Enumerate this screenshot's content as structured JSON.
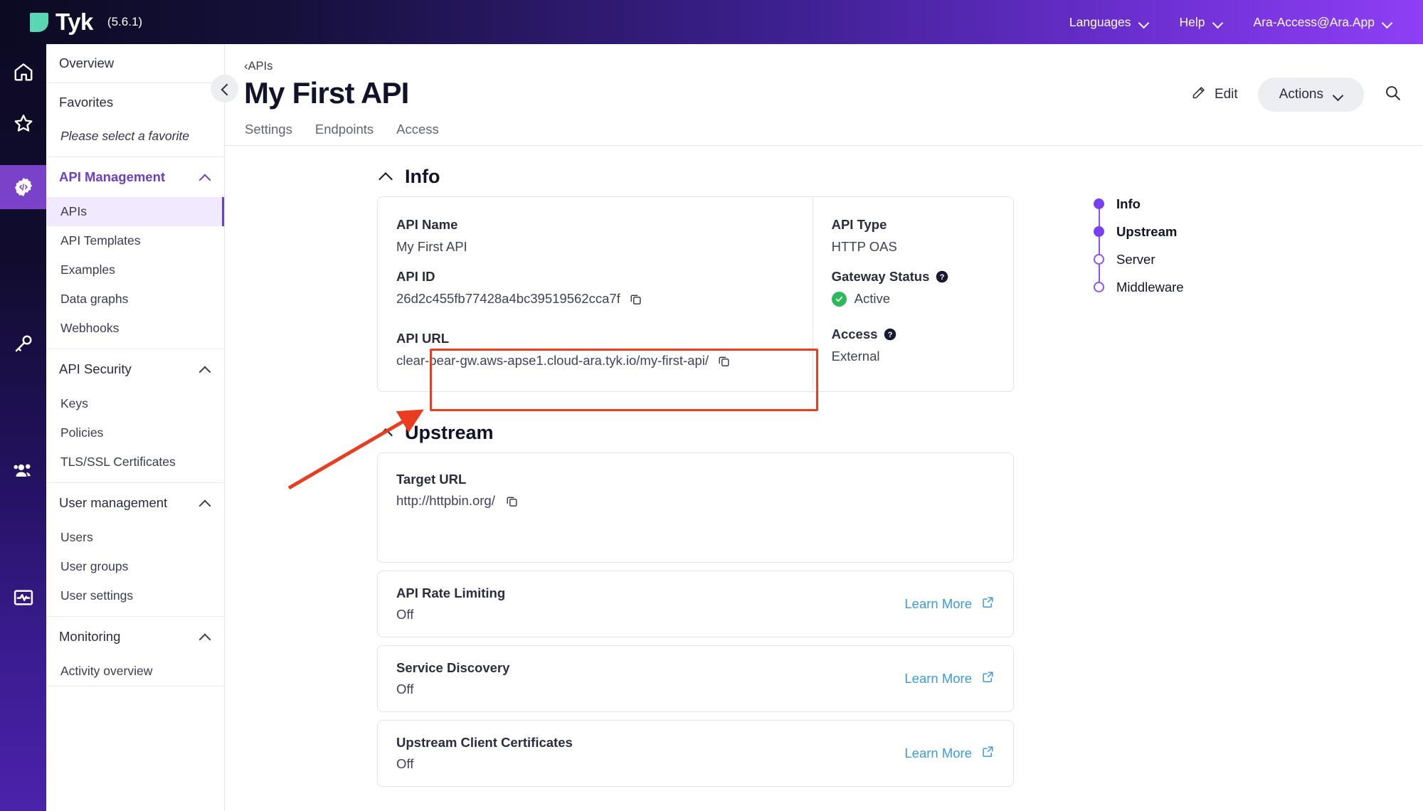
{
  "topbar": {
    "logo_word": "Tyk",
    "version": "(5.6.1)",
    "logo_icon": "tyk-logo-icon",
    "items": [
      {
        "label": "Languages",
        "icon": "chevron-down-icon"
      },
      {
        "label": "Help",
        "icon": "chevron-down-icon"
      },
      {
        "label": "Ara-Access@Ara.App",
        "icon": "chevron-down-icon"
      }
    ]
  },
  "rail": {
    "items": [
      {
        "name": "home-icon",
        "active": false
      },
      {
        "name": "star-icon",
        "active": false
      },
      {
        "name": "api-management-gear-code-icon",
        "active": true
      },
      {
        "name": "key-icon",
        "active": false
      },
      {
        "name": "users-icon",
        "active": false
      },
      {
        "name": "activity-monitor-icon",
        "active": false
      }
    ]
  },
  "sidebar": {
    "overview": "Overview",
    "favorites_title": "Favorites",
    "favorites_empty": "Please select a favorite",
    "collapse_icon": "chevron-left-icon",
    "groups": [
      {
        "title": "API Management",
        "active": true,
        "items": [
          {
            "label": "APIs",
            "selected": true
          },
          {
            "label": "API Templates",
            "selected": false
          },
          {
            "label": "Examples",
            "selected": false
          },
          {
            "label": "Data graphs",
            "selected": false
          },
          {
            "label": "Webhooks",
            "selected": false
          }
        ]
      },
      {
        "title": "API Security",
        "active": false,
        "items": [
          {
            "label": "Keys",
            "selected": false
          },
          {
            "label": "Policies",
            "selected": false
          },
          {
            "label": "TLS/SSL Certificates",
            "selected": false
          }
        ]
      },
      {
        "title": "User management",
        "active": false,
        "items": [
          {
            "label": "Users",
            "selected": false
          },
          {
            "label": "User groups",
            "selected": false
          },
          {
            "label": "User settings",
            "selected": false
          }
        ]
      },
      {
        "title": "Monitoring",
        "active": false,
        "items": [
          {
            "label": "Activity overview",
            "selected": false
          }
        ]
      }
    ]
  },
  "page": {
    "breadcrumb": "‹APIs",
    "title": "My First API",
    "edit_label": "Edit",
    "edit_icon": "pencil-icon",
    "actions_label": "Actions",
    "actions_icon": "chevron-down-icon",
    "search_icon": "search-icon",
    "tabs": [
      {
        "label": "Settings",
        "active": false
      },
      {
        "label": "Endpoints",
        "active": false
      },
      {
        "label": "Access",
        "active": false
      }
    ]
  },
  "info_section": {
    "title": "Info",
    "collapse_icon": "chevron-up-icon",
    "left_fields": [
      {
        "label": "API Name",
        "value": "My First API",
        "copy": false,
        "help": false
      },
      {
        "label": "API ID",
        "value": "26d2c455fb77428a4bc39519562cca7f",
        "copy": true,
        "help": false
      },
      {
        "label": "API URL",
        "value": "clear-bear-gw.aws-apse1.cloud-ara.tyk.io/my-first-api/",
        "copy": true,
        "help": false
      }
    ],
    "right_fields": [
      {
        "label": "API Type",
        "value": "HTTP OAS",
        "help": false,
        "status": false
      },
      {
        "label": "Gateway Status",
        "value": "Active",
        "help": true,
        "status": true
      },
      {
        "label": "Access",
        "value": "External",
        "help": true,
        "status": false
      }
    ]
  },
  "upstream_section": {
    "title": "Upstream",
    "collapse_icon": "chevron-up-icon",
    "target": {
      "label": "Target URL",
      "value": "http://httpbin.org/",
      "copy_icon": "copy-icon"
    },
    "rows": [
      {
        "name": "API Rate Limiting",
        "value": "Off",
        "link": "Learn More",
        "link_icon": "external-link-icon"
      },
      {
        "name": "Service Discovery",
        "value": "Off",
        "link": "Learn More",
        "link_icon": "external-link-icon"
      },
      {
        "name": "Upstream Client Certificates",
        "value": "Off",
        "link": "Learn More",
        "link_icon": "external-link-icon"
      }
    ]
  },
  "timeline": {
    "items": [
      {
        "label": "Info",
        "filled": true,
        "bold": true
      },
      {
        "label": "Upstream",
        "filled": true,
        "bold": true
      },
      {
        "label": "Server",
        "filled": false,
        "bold": false
      },
      {
        "label": "Middleware",
        "filled": false,
        "bold": false
      }
    ]
  },
  "annotation": {
    "highlight_target": "api-url-field",
    "color": "#ea3d1f"
  },
  "colors": {
    "accent_purple": "#6c3fc4",
    "timeline_purple": "#7b3ff2",
    "link_blue": "#3b9ae1",
    "status_green": "#2eb85c",
    "annotation_red": "#ea3d1f",
    "logo_teal": "#5ad6b4"
  }
}
